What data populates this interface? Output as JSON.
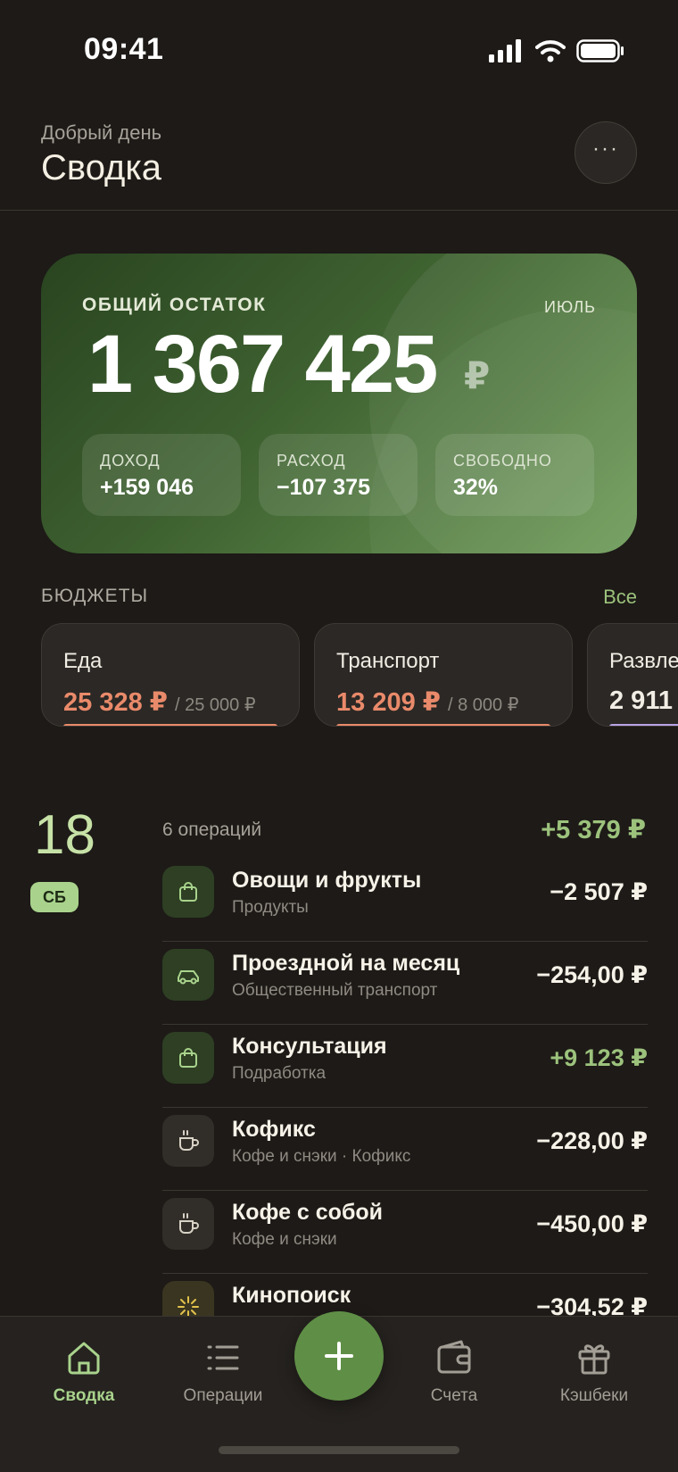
{
  "status_bar": {
    "time": "09:41",
    "icons": [
      "signal-icon",
      "wifi-icon",
      "battery-icon"
    ]
  },
  "header": {
    "greeting": "Добрый день",
    "title": "Сводка",
    "more_label": "···"
  },
  "balance": {
    "label": "ОБЩИЙ ОСТАТОК",
    "month": "ИЮЛЬ",
    "amount": "1 367 425",
    "currency": "₽",
    "stats": [
      {
        "label": "ДОХОД",
        "value": "+159 046"
      },
      {
        "label": "РАСХОД",
        "value": "−107 375"
      },
      {
        "label": "СВОБОДНО",
        "value": "32%"
      }
    ]
  },
  "budgets": {
    "title": "БЮДЖЕТЫ",
    "all_label": "Все",
    "items": [
      {
        "name": "Еда",
        "spent": "25 328 ₽",
        "limit": "/ 25 000 ₽",
        "progress": 1.0,
        "color": "#e98a6a"
      },
      {
        "name": "Транспорт",
        "spent": "13 209 ₽",
        "limit": "/ 8 000 ₽",
        "progress": 1.0,
        "color": "#e98a6a"
      },
      {
        "name": "Развле",
        "spent": "2 911",
        "limit": "",
        "color": "#b8a3e6"
      }
    ]
  },
  "day_group": {
    "day": "18",
    "weekday": "СБ",
    "count_label": "6 операций",
    "total": "+5 379 ₽",
    "transactions": [
      {
        "title": "Овощи и фрукты",
        "subtitle": "Продукты",
        "amount": "−2 507 ₽",
        "icon": "shopping-bag-icon",
        "positive": false
      },
      {
        "title": "Проездной на месяц",
        "subtitle": "Общественный транспорт",
        "amount": "−254,00 ₽",
        "icon": "car-icon",
        "positive": false
      },
      {
        "title": "Консультация",
        "subtitle": "Подработка",
        "amount": "+9 123 ₽",
        "icon": "shopping-bag-icon",
        "positive": true
      },
      {
        "title": "Кофикс",
        "subtitle": "Кофе и снэки · Кофикс",
        "amount": "−228,00 ₽",
        "icon": "coffee-cup-icon",
        "positive": false
      },
      {
        "title": "Кофе с собой",
        "subtitle": "Кофе и снэки",
        "amount": "−450,00 ₽",
        "icon": "coffee-cup-icon",
        "positive": false
      },
      {
        "title": "Кинопоиск",
        "subtitle": "",
        "amount": "−304,52 ₽",
        "icon": "sparkle-icon",
        "positive": false
      }
    ]
  },
  "nav": {
    "items": [
      {
        "label": "Сводка",
        "icon": "home-icon",
        "active": true
      },
      {
        "label": "Операции",
        "icon": "list-icon",
        "active": false
      },
      {
        "label": "Счета",
        "icon": "wallet-icon",
        "active": false
      },
      {
        "label": "Кэшбеки",
        "icon": "gift-icon",
        "active": false
      }
    ],
    "add_icon": "plus-icon"
  }
}
